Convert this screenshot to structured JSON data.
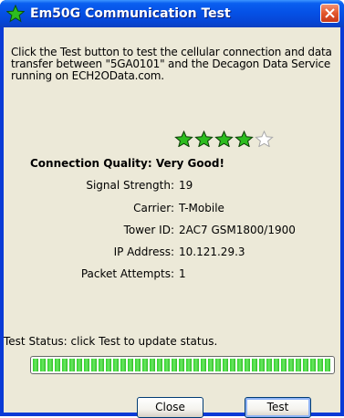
{
  "window": {
    "title": "Em50G Communication Test",
    "icon": "green-star-icon",
    "close_icon": "close-icon"
  },
  "intro_text": "Click the Test button to test the cellular connection and data transfer between \"5GA0101\" and the Decagon Data Service running on ECH2OData.com.",
  "rating": {
    "filled": 4,
    "max": 5,
    "star_color": "#2dbd1f"
  },
  "quality": {
    "label": "Connection Quality:",
    "value": "Very Good!"
  },
  "details": [
    {
      "label": "Signal Strength:",
      "value": "19"
    },
    {
      "label": "Carrier:",
      "value": "T-Mobile"
    },
    {
      "label": "Tower ID:",
      "value": "2AC7 GSM1800/1900"
    },
    {
      "label": "IP Address:",
      "value": "10.121.29.3"
    },
    {
      "label": "Packet Attempts:",
      "value": "1"
    }
  ],
  "status_text": "Test Status: click Test to update status.",
  "progress": 1.0,
  "buttons": {
    "close": "Close",
    "test": "Test"
  }
}
